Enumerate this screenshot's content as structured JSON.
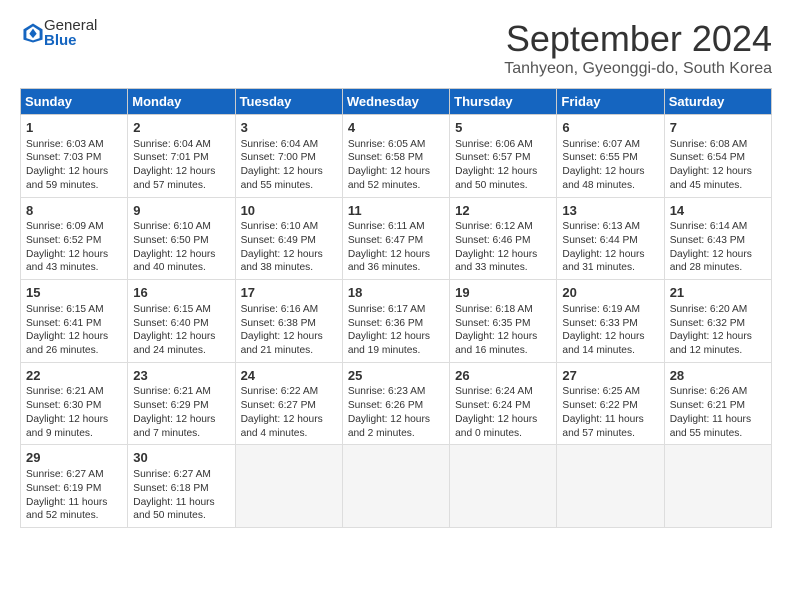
{
  "header": {
    "logo_general": "General",
    "logo_blue": "Blue",
    "month_title": "September 2024",
    "subtitle": "Tanhyeon, Gyeonggi-do, South Korea"
  },
  "weekdays": [
    "Sunday",
    "Monday",
    "Tuesday",
    "Wednesday",
    "Thursday",
    "Friday",
    "Saturday"
  ],
  "weeks": [
    [
      {
        "day": "1",
        "lines": [
          "Sunrise: 6:03 AM",
          "Sunset: 7:03 PM",
          "Daylight: 12 hours",
          "and 59 minutes."
        ]
      },
      {
        "day": "2",
        "lines": [
          "Sunrise: 6:04 AM",
          "Sunset: 7:01 PM",
          "Daylight: 12 hours",
          "and 57 minutes."
        ]
      },
      {
        "day": "3",
        "lines": [
          "Sunrise: 6:04 AM",
          "Sunset: 7:00 PM",
          "Daylight: 12 hours",
          "and 55 minutes."
        ]
      },
      {
        "day": "4",
        "lines": [
          "Sunrise: 6:05 AM",
          "Sunset: 6:58 PM",
          "Daylight: 12 hours",
          "and 52 minutes."
        ]
      },
      {
        "day": "5",
        "lines": [
          "Sunrise: 6:06 AM",
          "Sunset: 6:57 PM",
          "Daylight: 12 hours",
          "and 50 minutes."
        ]
      },
      {
        "day": "6",
        "lines": [
          "Sunrise: 6:07 AM",
          "Sunset: 6:55 PM",
          "Daylight: 12 hours",
          "and 48 minutes."
        ]
      },
      {
        "day": "7",
        "lines": [
          "Sunrise: 6:08 AM",
          "Sunset: 6:54 PM",
          "Daylight: 12 hours",
          "and 45 minutes."
        ]
      }
    ],
    [
      {
        "day": "8",
        "lines": [
          "Sunrise: 6:09 AM",
          "Sunset: 6:52 PM",
          "Daylight: 12 hours",
          "and 43 minutes."
        ]
      },
      {
        "day": "9",
        "lines": [
          "Sunrise: 6:10 AM",
          "Sunset: 6:50 PM",
          "Daylight: 12 hours",
          "and 40 minutes."
        ]
      },
      {
        "day": "10",
        "lines": [
          "Sunrise: 6:10 AM",
          "Sunset: 6:49 PM",
          "Daylight: 12 hours",
          "and 38 minutes."
        ]
      },
      {
        "day": "11",
        "lines": [
          "Sunrise: 6:11 AM",
          "Sunset: 6:47 PM",
          "Daylight: 12 hours",
          "and 36 minutes."
        ]
      },
      {
        "day": "12",
        "lines": [
          "Sunrise: 6:12 AM",
          "Sunset: 6:46 PM",
          "Daylight: 12 hours",
          "and 33 minutes."
        ]
      },
      {
        "day": "13",
        "lines": [
          "Sunrise: 6:13 AM",
          "Sunset: 6:44 PM",
          "Daylight: 12 hours",
          "and 31 minutes."
        ]
      },
      {
        "day": "14",
        "lines": [
          "Sunrise: 6:14 AM",
          "Sunset: 6:43 PM",
          "Daylight: 12 hours",
          "and 28 minutes."
        ]
      }
    ],
    [
      {
        "day": "15",
        "lines": [
          "Sunrise: 6:15 AM",
          "Sunset: 6:41 PM",
          "Daylight: 12 hours",
          "and 26 minutes."
        ]
      },
      {
        "day": "16",
        "lines": [
          "Sunrise: 6:15 AM",
          "Sunset: 6:40 PM",
          "Daylight: 12 hours",
          "and 24 minutes."
        ]
      },
      {
        "day": "17",
        "lines": [
          "Sunrise: 6:16 AM",
          "Sunset: 6:38 PM",
          "Daylight: 12 hours",
          "and 21 minutes."
        ]
      },
      {
        "day": "18",
        "lines": [
          "Sunrise: 6:17 AM",
          "Sunset: 6:36 PM",
          "Daylight: 12 hours",
          "and 19 minutes."
        ]
      },
      {
        "day": "19",
        "lines": [
          "Sunrise: 6:18 AM",
          "Sunset: 6:35 PM",
          "Daylight: 12 hours",
          "and 16 minutes."
        ]
      },
      {
        "day": "20",
        "lines": [
          "Sunrise: 6:19 AM",
          "Sunset: 6:33 PM",
          "Daylight: 12 hours",
          "and 14 minutes."
        ]
      },
      {
        "day": "21",
        "lines": [
          "Sunrise: 6:20 AM",
          "Sunset: 6:32 PM",
          "Daylight: 12 hours",
          "and 12 minutes."
        ]
      }
    ],
    [
      {
        "day": "22",
        "lines": [
          "Sunrise: 6:21 AM",
          "Sunset: 6:30 PM",
          "Daylight: 12 hours",
          "and 9 minutes."
        ]
      },
      {
        "day": "23",
        "lines": [
          "Sunrise: 6:21 AM",
          "Sunset: 6:29 PM",
          "Daylight: 12 hours",
          "and 7 minutes."
        ]
      },
      {
        "day": "24",
        "lines": [
          "Sunrise: 6:22 AM",
          "Sunset: 6:27 PM",
          "Daylight: 12 hours",
          "and 4 minutes."
        ]
      },
      {
        "day": "25",
        "lines": [
          "Sunrise: 6:23 AM",
          "Sunset: 6:26 PM",
          "Daylight: 12 hours",
          "and 2 minutes."
        ]
      },
      {
        "day": "26",
        "lines": [
          "Sunrise: 6:24 AM",
          "Sunset: 6:24 PM",
          "Daylight: 12 hours",
          "and 0 minutes."
        ]
      },
      {
        "day": "27",
        "lines": [
          "Sunrise: 6:25 AM",
          "Sunset: 6:22 PM",
          "Daylight: 11 hours",
          "and 57 minutes."
        ]
      },
      {
        "day": "28",
        "lines": [
          "Sunrise: 6:26 AM",
          "Sunset: 6:21 PM",
          "Daylight: 11 hours",
          "and 55 minutes."
        ]
      }
    ],
    [
      {
        "day": "29",
        "lines": [
          "Sunrise: 6:27 AM",
          "Sunset: 6:19 PM",
          "Daylight: 11 hours",
          "and 52 minutes."
        ]
      },
      {
        "day": "30",
        "lines": [
          "Sunrise: 6:27 AM",
          "Sunset: 6:18 PM",
          "Daylight: 11 hours",
          "and 50 minutes."
        ]
      },
      null,
      null,
      null,
      null,
      null
    ]
  ]
}
